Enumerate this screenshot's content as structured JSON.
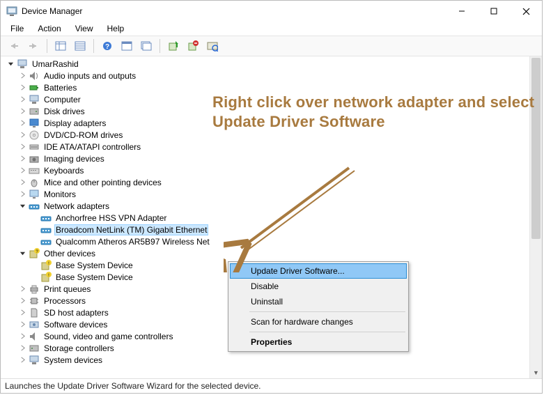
{
  "window": {
    "title": "Device Manager"
  },
  "menubar": [
    "File",
    "Action",
    "View",
    "Help"
  ],
  "tree": {
    "root": "UmarRashid",
    "top_level": [
      "Audio inputs and outputs",
      "Batteries",
      "Computer",
      "Disk drives",
      "Display adapters",
      "DVD/CD-ROM drives",
      "IDE ATA/ATAPI controllers",
      "Imaging devices",
      "Keyboards",
      "Mice and other pointing devices",
      "Monitors"
    ],
    "network": {
      "label": "Network adapters",
      "children": [
        "Anchorfree HSS VPN Adapter",
        "Broadcom NetLink (TM) Gigabit Ethernet",
        "Qualcomm Atheros AR5B97 Wireless Net"
      ]
    },
    "other": {
      "label": "Other devices",
      "children": [
        "Base System Device",
        "Base System Device"
      ]
    },
    "bottom_level": [
      "Print queues",
      "Processors",
      "SD host adapters",
      "Software devices",
      "Sound, video and game controllers",
      "Storage controllers",
      "System devices"
    ]
  },
  "context_menu": {
    "update": "Update Driver Software...",
    "disable": "Disable",
    "uninstall": "Uninstall",
    "scan": "Scan for hardware changes",
    "properties": "Properties"
  },
  "statusbar": "Launches the Update Driver Software Wizard for the selected device.",
  "annotation": "Right click over network adapter and select Update Driver Software"
}
